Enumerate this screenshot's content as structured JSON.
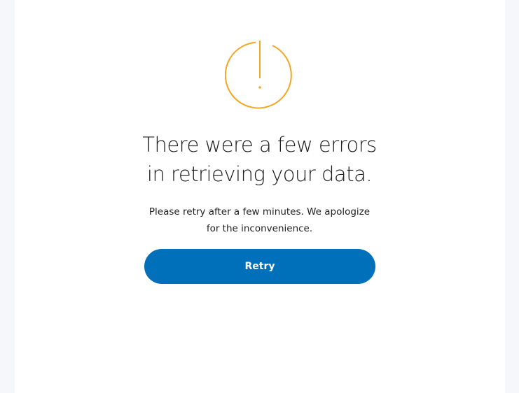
{
  "error_page": {
    "icon": "alert-circle-icon",
    "heading_line1": "There were a few errors",
    "heading_line2": "in retrieving your data.",
    "message_line1": "Please retry after a few minutes. We apologize",
    "message_line2": "for the inconvenience.",
    "retry_label": "Retry"
  },
  "colors": {
    "accent": "#0070ba",
    "warning": "#f5a623",
    "background": "#f5f7fa",
    "panel": "#ffffff"
  }
}
